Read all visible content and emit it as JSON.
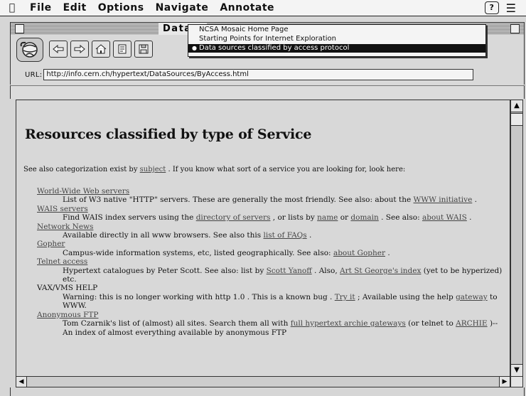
{
  "menubar": {
    "apple_icon": "apple-icon",
    "items": [
      "File",
      "Edit",
      "Options",
      "Navigate",
      "Annotate"
    ],
    "help_icon": "?",
    "app_icon": "mosaic-app-icon"
  },
  "window": {
    "title": "Data s"
  },
  "toolbar": {
    "globe_icon": "spinning-globe-icon",
    "buttons": [
      "back-arrow-icon",
      "forward-arrow-icon",
      "home-icon",
      "reload-icon",
      "save-disk-icon"
    ],
    "url_label": "URL:",
    "url_value": "http://info.cern.ch/hypertext/DataSources/ByAccess.html"
  },
  "history_menu": {
    "items": [
      "NCSA Mosaic Home Page",
      "Starting Points for Internet Exploration",
      "Data sources classified by access protocol"
    ],
    "selected_index": 2
  },
  "page": {
    "heading": "Resources classified by type of Service",
    "intro_pre": "See also categorization exist by ",
    "intro_link": "subject",
    "intro_post": " . If you know what sort of a service you are looking for, look here:",
    "entries": [
      {
        "title": "World-Wide Web servers",
        "title_link": true,
        "desc": [
          {
            "t": "List of W3 native \"HTTP\" servers. These are generally the most friendly. See also: about the "
          },
          {
            "t": "WWW initiative",
            "link": true
          },
          {
            "t": " ."
          }
        ]
      },
      {
        "title": "WAIS servers",
        "title_link": true,
        "desc": [
          {
            "t": "Find WAIS index servers using the "
          },
          {
            "t": "directory of servers",
            "link": true
          },
          {
            "t": " , or lists by "
          },
          {
            "t": "name",
            "link": true
          },
          {
            "t": " or "
          },
          {
            "t": "domain",
            "link": true
          },
          {
            "t": " . See also: "
          },
          {
            "t": "about WAIS",
            "link": true
          },
          {
            "t": " ."
          }
        ]
      },
      {
        "title": "Network News",
        "title_link": true,
        "desc": [
          {
            "t": "Available directly in all www browsers. See also this "
          },
          {
            "t": "list of FAQs",
            "link": true
          },
          {
            "t": " ."
          }
        ]
      },
      {
        "title": "Gopher",
        "title_link": true,
        "desc": [
          {
            "t": "Campus-wide information systems, etc, listed geographically. See also: "
          },
          {
            "t": "about Gopher",
            "link": true
          },
          {
            "t": " ."
          }
        ]
      },
      {
        "title": "Telnet access",
        "title_link": true,
        "desc": [
          {
            "t": "Hypertext catalogues by Peter Scott. See also: list by "
          },
          {
            "t": "Scott Yanoff",
            "link": true
          },
          {
            "t": " . Also, "
          },
          {
            "t": "Art St George's index",
            "link": true
          },
          {
            "t": " (yet to be hyperized) etc."
          }
        ]
      },
      {
        "title": "VAX/VMS HELP",
        "title_link": false,
        "desc": [
          {
            "t": "Warning: this is no longer working with http 1.0 . This is a known bug . "
          },
          {
            "t": "Try it",
            "link": true
          },
          {
            "t": " ; Available using the help "
          },
          {
            "t": "gateway",
            "link": true
          },
          {
            "t": " to WWW."
          }
        ]
      },
      {
        "title": "Anonymous FTP",
        "title_link": true,
        "desc": [
          {
            "t": "Tom Czarnik's list of (almost) all sites. Search them all with "
          },
          {
            "t": "full hypertext archie gateways",
            "link": true
          },
          {
            "t": " (or telnet to "
          },
          {
            "t": "ARCHIE",
            "link": true
          },
          {
            "t": " )-- An index of almost everything available by anonymous FTP"
          }
        ]
      }
    ]
  }
}
